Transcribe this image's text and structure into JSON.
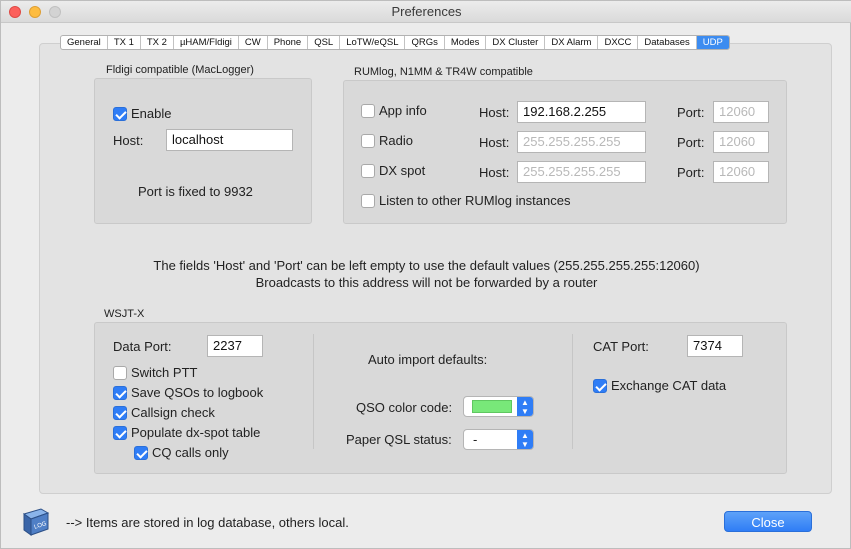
{
  "window": {
    "title": "Preferences"
  },
  "tabs": [
    "General",
    "TX 1",
    "TX 2",
    "µHAM/Fldigi",
    "CW",
    "Phone",
    "QSL",
    "LoTW/eQSL",
    "QRGs",
    "Modes",
    "DX Cluster",
    "DX Alarm",
    "DXCC",
    "Databases",
    "UDP"
  ],
  "active_tab": "UDP",
  "fldigi": {
    "label": "Fldigi compatible (MacLogger)",
    "enable_label": "Enable",
    "enable_checked": true,
    "host_label": "Host:",
    "host_value": "localhost",
    "port_note": "Port is fixed to 9932"
  },
  "rumlog": {
    "label": "RUMlog, N1MM & TR4W compatible",
    "rows": [
      {
        "label": "App info",
        "checked": false,
        "host_label": "Host:",
        "host": "192.168.2.255",
        "host_placeholder": false,
        "port_label": "Port:",
        "port": "12060"
      },
      {
        "label": "Radio",
        "checked": false,
        "host_label": "Host:",
        "host": "255.255.255.255",
        "host_placeholder": true,
        "port_label": "Port:",
        "port": "12060"
      },
      {
        "label": "DX spot",
        "checked": false,
        "host_label": "Host:",
        "host": "255.255.255.255",
        "host_placeholder": true,
        "port_label": "Port:",
        "port": "12060"
      }
    ],
    "listen_label": "Listen to other RUMlog instances",
    "listen_checked": false
  },
  "notes": {
    "line1": "The fields 'Host' and 'Port' can be left empty to use the default values (255.255.255.255:12060)",
    "line2": "Broadcasts to this address will not be forwarded by a router"
  },
  "wsjtx": {
    "label": "WSJT-X",
    "data_port_label": "Data Port:",
    "data_port": "2237",
    "options": [
      {
        "label": "Switch PTT",
        "checked": false
      },
      {
        "label": "Save QSOs to logbook",
        "checked": true
      },
      {
        "label": "Callsign check",
        "checked": true
      },
      {
        "label": "Populate dx-spot table",
        "checked": true
      },
      {
        "label": "CQ calls only",
        "checked": true
      }
    ],
    "auto_import_label": "Auto import defaults:",
    "qso_color_label": "QSO color code:",
    "qso_color": "#78e879",
    "paper_qsl_label": "Paper QSL status:",
    "paper_qsl_value": "-",
    "cat_port_label": "CAT Port:",
    "cat_port": "7374",
    "exchange_cat_label": "Exchange CAT data",
    "exchange_cat_checked": true
  },
  "footer": {
    "info": "--> Items are stored in log database, others local.",
    "close_label": "Close",
    "icon": "logbook-icon"
  },
  "colors": {
    "accent": "#2f7df6"
  }
}
